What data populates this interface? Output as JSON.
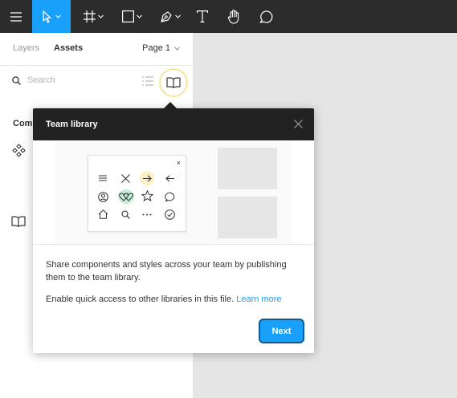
{
  "toolbar": {
    "menu_icon": "hamburger-icon",
    "tools": [
      "move-tool",
      "frame-tool",
      "shape-tool",
      "pen-tool",
      "text-tool",
      "hand-tool",
      "comment-tool"
    ],
    "accent": "#18a0fb",
    "background": "#2c2c2c"
  },
  "sidebar": {
    "tabs": {
      "layers": "Layers",
      "assets": "Assets"
    },
    "page_label": "Page 1",
    "search": {
      "placeholder": "Search",
      "value": ""
    },
    "section_label": "Com"
  },
  "modal": {
    "title": "Team library",
    "description_1": "Share components and styles across your team by publishing them to the team library.",
    "description_2": "Enable quick access to other libraries in this file.",
    "learn_more": "Learn more",
    "next_label": "Next",
    "card_close": "×",
    "icon_grid": [
      "menu-icon",
      "close-icon",
      "arrow-right-icon",
      "arrow-left-icon",
      "user-icon",
      "hearts-icon",
      "star-icon",
      "speech-icon",
      "home-icon",
      "search-icon",
      "more-icon",
      "check-icon"
    ]
  }
}
